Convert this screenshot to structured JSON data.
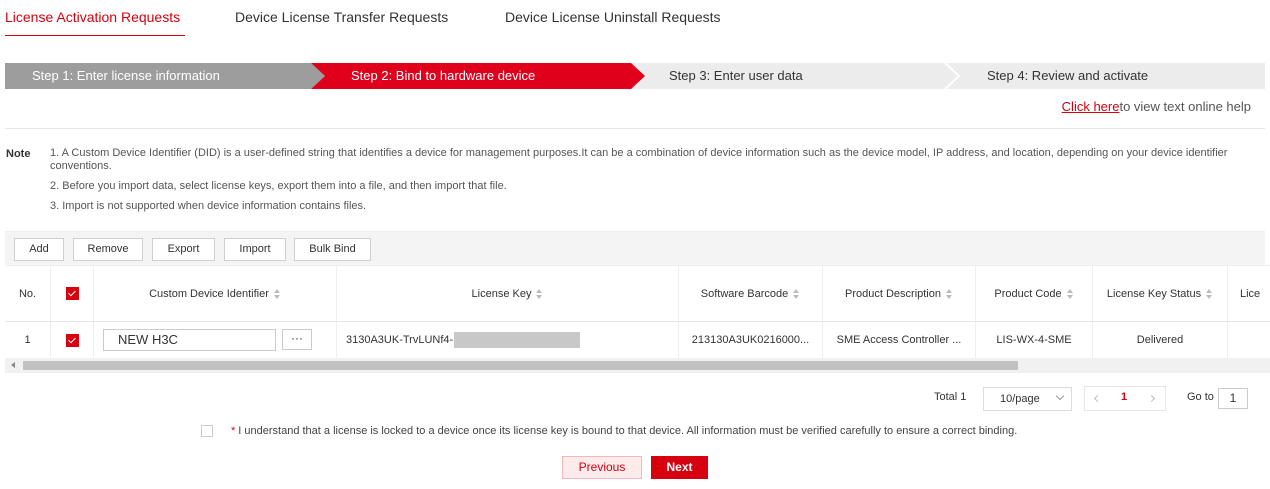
{
  "tabs": [
    {
      "label": "License Activation Requests",
      "active": true
    },
    {
      "label": "Device License Transfer Requests",
      "active": false
    },
    {
      "label": "Device License Uninstall Requests",
      "active": false
    }
  ],
  "steps": [
    {
      "label": "Step 1: Enter license information",
      "state": "done"
    },
    {
      "label": "Step 2: Bind to hardware device",
      "state": "current"
    },
    {
      "label": "Step 3: Enter user data",
      "state": "todo"
    },
    {
      "label": "Step 4: Review and activate",
      "state": "todo"
    }
  ],
  "help": {
    "link": "Click here",
    "text": "to view text online help"
  },
  "note": {
    "label": "Note",
    "items": [
      "1. A Custom Device Identifier (DID) is a user-defined string that identifies a device for management purposes.It can be a combination of device information such as the device model, IP address, and location, depending on your device identifier conventions.",
      "2. Before you import data, select license keys, export them into a file, and then import that file.",
      "3. Import is not supported when device information contains files."
    ]
  },
  "toolbar": {
    "add": "Add",
    "remove": "Remove",
    "export": "Export",
    "import": "Import",
    "bulk_bind": "Bulk Bind"
  },
  "table": {
    "headers": {
      "no": "No.",
      "did": "Custom Device Identifier",
      "license_key": "License Key",
      "barcode": "Software Barcode",
      "description": "Product Description",
      "code": "Product Code",
      "status": "License Key Status",
      "more": "Lice"
    },
    "rows": [
      {
        "no": "1",
        "checked": true,
        "did": "NEW H3C",
        "more_btn": "···",
        "license_key": "3130A3UK-TrvLUNf4-",
        "barcode": "213130A3UK0216000...",
        "description": "SME Access Controller ...",
        "code": "LIS-WX-4-SME",
        "status": "Delivered"
      }
    ]
  },
  "pagination": {
    "total": "Total 1",
    "page_size": "10/page",
    "current_page": "1",
    "goto_label": "Go to",
    "goto_value": "1"
  },
  "agreement": {
    "star": "*",
    "text": "I understand that a license is locked to a device once its license key is bound to that device. All information must be verified carefully to ensure a correct binding."
  },
  "buttons": {
    "previous": "Previous",
    "next": "Next"
  },
  "colors": {
    "accent": "#d7000f",
    "step_done": "#9d9d9d",
    "step_todo": "#ececec"
  }
}
